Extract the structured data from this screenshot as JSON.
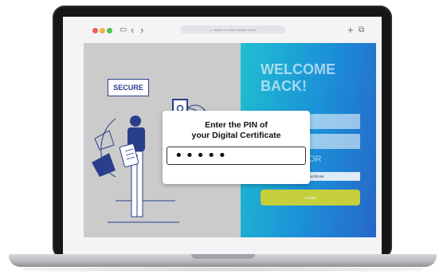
{
  "browser": {
    "address_text": "Search or enter website name",
    "search_icon": "search-icon",
    "sidebar_icon": "sidebar-icon",
    "back_icon": "chevron-left-icon",
    "forward_icon": "chevron-right-icon",
    "new_tab_icon": "plus-icon",
    "tabs_icon": "tabs-icon",
    "glyphs": {
      "sidebar": "▭",
      "back": "‹",
      "forward": "›",
      "plus": "+",
      "tabs": "⧉",
      "search": "⌕"
    }
  },
  "illustration": {
    "badge_label": "SECURE",
    "shield_icon": "shield-key-icon"
  },
  "login": {
    "welcome_line1": "WELCOME",
    "welcome_line2": "BACK!",
    "or_label": "OR",
    "certificate_button": "Digital Certificate",
    "login_button": "LOGIN"
  },
  "dialog": {
    "title_line1": "Enter the PIN of",
    "title_line2": "your Digital Certificate",
    "pin_value": "•••••"
  },
  "colors": {
    "right_panel_start": "#1ec0d0",
    "right_panel_end": "#2667c8",
    "login_button": "#c5cf3c",
    "illustration_blue": "#2a3f8c"
  }
}
